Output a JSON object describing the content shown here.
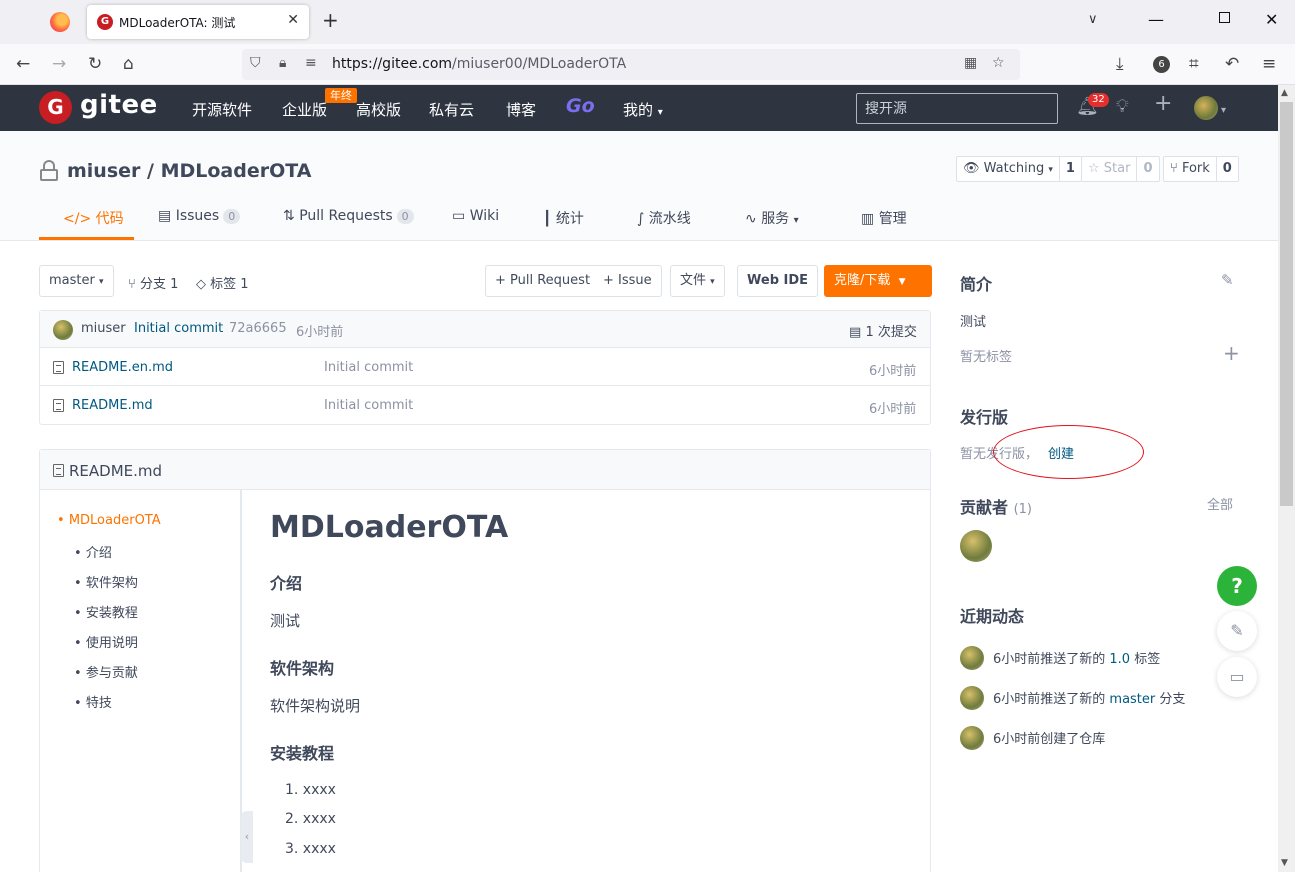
{
  "browser": {
    "tab_title": "MDLoaderOTA: 测试",
    "tab_favicon": "G",
    "url_host": "https://gitee.com",
    "url_path": "/miuser00/MDLoaderOTA",
    "extension_badge": "6"
  },
  "gitee_header": {
    "logo_mark": "G",
    "logo_text": "gitee",
    "nav": [
      "开源软件",
      "企业版",
      "高校版",
      "私有云",
      "博客",
      "Go",
      "我的"
    ],
    "year_badge": "年终",
    "search_placeholder": "搜开源",
    "notification_count": "32",
    "colors": {
      "bg": "#2e3440",
      "brand": "#c71d23",
      "accent": "#fe7300"
    }
  },
  "repo": {
    "owner": "miuser",
    "name": "MDLoaderOTA",
    "title": "miuser / MDLoaderOTA",
    "watch_label": "Watching",
    "watch_count": "1",
    "star_label": "Star",
    "star_count": "0",
    "fork_label": "Fork",
    "fork_count": "0",
    "tabs": [
      {
        "label": "代码",
        "icon": "code-icon",
        "active": true
      },
      {
        "label": "Issues",
        "count": "0",
        "icon": "issues-icon"
      },
      {
        "label": "Pull Requests",
        "count": "0",
        "icon": "pull-request-icon"
      },
      {
        "label": "Wiki",
        "icon": "book-icon"
      },
      {
        "label": "统计",
        "icon": "bar-chart-icon"
      },
      {
        "label": "流水线",
        "icon": "pipeline-icon"
      },
      {
        "label": "服务",
        "icon": "pulse-icon"
      },
      {
        "label": "管理",
        "icon": "manage-icon"
      }
    ]
  },
  "toolbar": {
    "branch": "master",
    "branches_label": "分支 1",
    "tags_label": "标签 1",
    "pull_request_btn": "+ Pull Request",
    "issue_btn": "+ Issue",
    "file_btn": "文件",
    "webide_btn": "Web IDE",
    "clone_btn": "克隆/下载"
  },
  "latest_commit": {
    "author": "miuser",
    "message": "Initial commit",
    "hash": "72a6665",
    "time": "6小时前",
    "commit_count": "1 次提交"
  },
  "files": [
    {
      "name": "README.en.md",
      "commit": "Initial commit",
      "time": "6小时前"
    },
    {
      "name": "README.md",
      "commit": "Initial commit",
      "time": "6小时前"
    }
  ],
  "readme": {
    "filename": "README.md",
    "toc": [
      "MDLoaderOTA",
      "介绍",
      "软件架构",
      "安装教程",
      "使用说明",
      "参与贡献",
      "特技"
    ],
    "h1": "MDLoaderOTA",
    "h_intro": "介绍",
    "p_intro": "测试",
    "h_arch": "软件架构",
    "p_arch": "软件架构说明",
    "h_install": "安装教程",
    "list": [
      "1. xxxx",
      "2. xxxx",
      "3. xxxx"
    ]
  },
  "sidebar": {
    "intro_title": "简介",
    "intro_text": "测试",
    "no_tags": "暂无标签",
    "release_title": "发行版",
    "no_release": "暂无发行版，",
    "create_link": "创建",
    "contributors_title": "贡献者",
    "contributors_count": "(1)",
    "all_link": "全部",
    "activity_title": "近期动态",
    "activity": [
      {
        "pre": "6小时前推送了新的 ",
        "link": "1.0",
        "post": " 标签"
      },
      {
        "pre": "6小时前推送了新的 ",
        "link": "master",
        "post": " 分支"
      },
      {
        "pre": "6小时前创建了仓库",
        "link": "",
        "post": ""
      }
    ]
  },
  "floating": {
    "help": "?"
  }
}
